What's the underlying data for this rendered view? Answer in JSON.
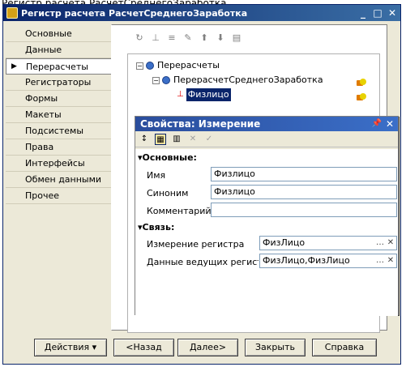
{
  "header_caption": "Регистр расчета РасчетСреднегоЗаработка",
  "window": {
    "title": "Регистр расчета РасчетСреднегоЗаработка",
    "controls": [
      "_",
      "□",
      "✕"
    ]
  },
  "nav": {
    "items": [
      "Основные",
      "Данные",
      "Перерасчеты",
      "Регистраторы",
      "Формы",
      "Макеты",
      "Подсистемы",
      "Права",
      "Интерфейсы",
      "Обмен данными",
      "Прочее"
    ],
    "active_index": 2
  },
  "toolbar_icons": [
    "refresh-icon",
    "tree-icon",
    "add-icon",
    "edit-icon",
    "move-up-icon",
    "move-down-icon",
    "sort-icon"
  ],
  "tree": {
    "root": "Перерасчеты",
    "child": "ПерерасчетСреднегоЗаработка",
    "leaf": "Физлицо"
  },
  "props": {
    "title": "Свойства: Измерение",
    "group_basic": "Основные:",
    "group_link": "Связь:",
    "labels": {
      "name": "Имя",
      "synonym": "Синоним",
      "comment": "Комментарий",
      "dimension": "Измерение регистра",
      "leading": "Данные ведущих регистр"
    },
    "values": {
      "name": "Физлицо",
      "synonym": "Физлицо",
      "comment": "",
      "dimension": "ФизЛицо",
      "leading": "ФизЛицо,ФизЛицо"
    }
  },
  "buttons": {
    "actions": "Действия",
    "back": "<Назад",
    "next": "Далее>",
    "close": "Закрыть",
    "help": "Справка"
  },
  "colors": {
    "titlebar": "#0a246a",
    "selection": "#0a246a",
    "face": "#ece9d8"
  }
}
